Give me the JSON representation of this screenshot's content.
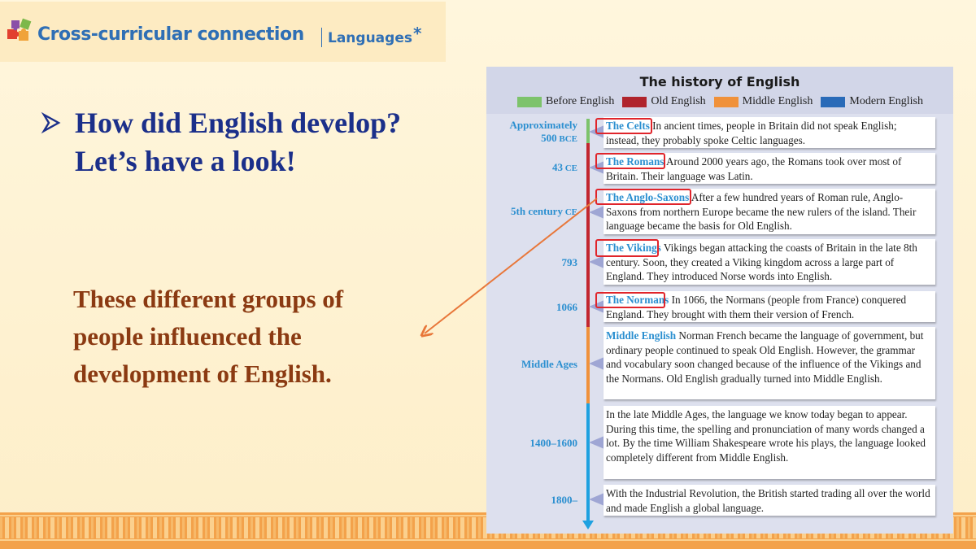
{
  "header": {
    "title": "Cross-curricular connection",
    "subtitle": "Languages",
    "star": "*"
  },
  "question": {
    "line1": "How did English develop?",
    "line2": "Let’s have a look!"
  },
  "statement": "These different groups of people influenced the development of English.",
  "panel": {
    "title": "The history of English",
    "legend": [
      {
        "label": "Before English",
        "color": "#7dc36b"
      },
      {
        "label": "Old English",
        "color": "#b0242c"
      },
      {
        "label": "Middle English",
        "color": "#f0913a"
      },
      {
        "label": "Modern English",
        "color": "#2a6bb8"
      }
    ],
    "entries": [
      {
        "date": "Approximately",
        "date2": "500",
        "date_unit": "BCE",
        "head": "The Celts",
        "text": " In ancient times, people in Britain did not speak English; instead, they probably spoke Celtic languages."
      },
      {
        "date": "43",
        "date2": "",
        "date_unit": "CE",
        "head": "The Romans",
        "text": " Around 2000 years ago, the Romans took over most of Britain. Their language was Latin."
      },
      {
        "date": "5th century",
        "date2": "",
        "date_unit": "CE",
        "head": "The Anglo-Saxons",
        "text": " After a few hundred years of Roman rule, Anglo-Saxons from northern Europe became the new rulers of the island. Their language became the basis for Old English."
      },
      {
        "date": "793",
        "date2": "",
        "date_unit": "",
        "head": "The Vikings",
        "text": " Vikings began attacking the coasts of Britain in the late 8th century. Soon, they created a Viking kingdom across a large part of England. They introduced Norse words into English."
      },
      {
        "date": "1066",
        "date2": "",
        "date_unit": "",
        "head": "The Normans",
        "text": " In 1066, the Normans (people from France) conquered England. They brought with them their version of French."
      },
      {
        "date": "Middle Ages",
        "date2": "",
        "date_unit": "",
        "head": "Middle English",
        "text": " Norman French became the language of government, but ordinary people continued to speak Old English. However, the grammar and vocabulary soon changed because of the influence of the Vikings and the Normans. Old English gradually turned into Middle English."
      },
      {
        "date": "1400–1600",
        "date2": "",
        "date_unit": "",
        "head": "",
        "text": "In the late Middle Ages, the language we know today began to appear. During this time, the spelling and pronunciation of many words changed a lot. By the time William Shakespeare wrote his plays, the language looked completely different from Middle English."
      },
      {
        "date": "1800–",
        "date2": "",
        "date_unit": "",
        "head": "",
        "text": "With the Industrial Revolution, the British started trading all over the world and made English a global language."
      }
    ]
  },
  "colors": {
    "question": "#1b2f8a",
    "statement": "#8b3a12",
    "header": "#2f6fb5",
    "highlight": "#e0252b",
    "annotation_arrow": "#e8773a"
  }
}
